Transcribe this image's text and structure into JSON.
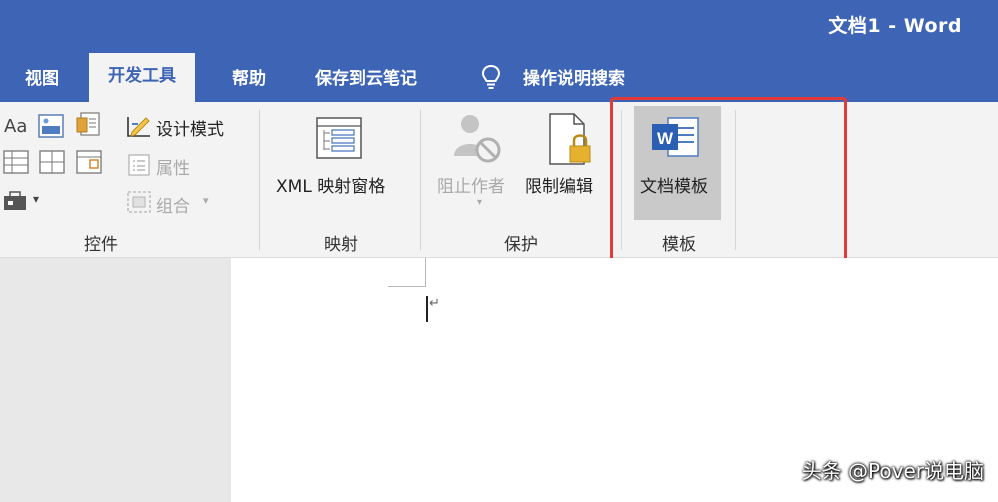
{
  "window": {
    "title": "文档1  -  Word"
  },
  "tabs": [
    {
      "label": "视图"
    },
    {
      "label": "开发工具",
      "active": true
    },
    {
      "label": "帮助"
    },
    {
      "label": "保存到云笔记"
    },
    {
      "label": "操作说明搜索"
    }
  ],
  "ribbon": {
    "controls": {
      "label": "控件",
      "design_mode": "设计模式",
      "properties": "属性",
      "group": "组合",
      "aa_glyph": "Aa"
    },
    "mapping": {
      "label": "映射",
      "xml_pane": "XML 映射窗格"
    },
    "protect": {
      "label": "保护",
      "block_authors": "阻止作者",
      "restrict_editing": "限制编辑"
    },
    "templates": {
      "label": "模板",
      "document_template": "文档模板"
    }
  },
  "watermark": "头条 @Pover说电脑",
  "colors": {
    "accent": "#3e65b5",
    "highlight_box": "#e23a3a",
    "disabled": "#a9a9a9"
  },
  "icons": [
    "lightbulb-icon",
    "design-mode-icon",
    "properties-icon",
    "group-icon",
    "xml-mapping-icon",
    "block-authors-icon",
    "restrict-editing-icon",
    "word-template-icon"
  ]
}
